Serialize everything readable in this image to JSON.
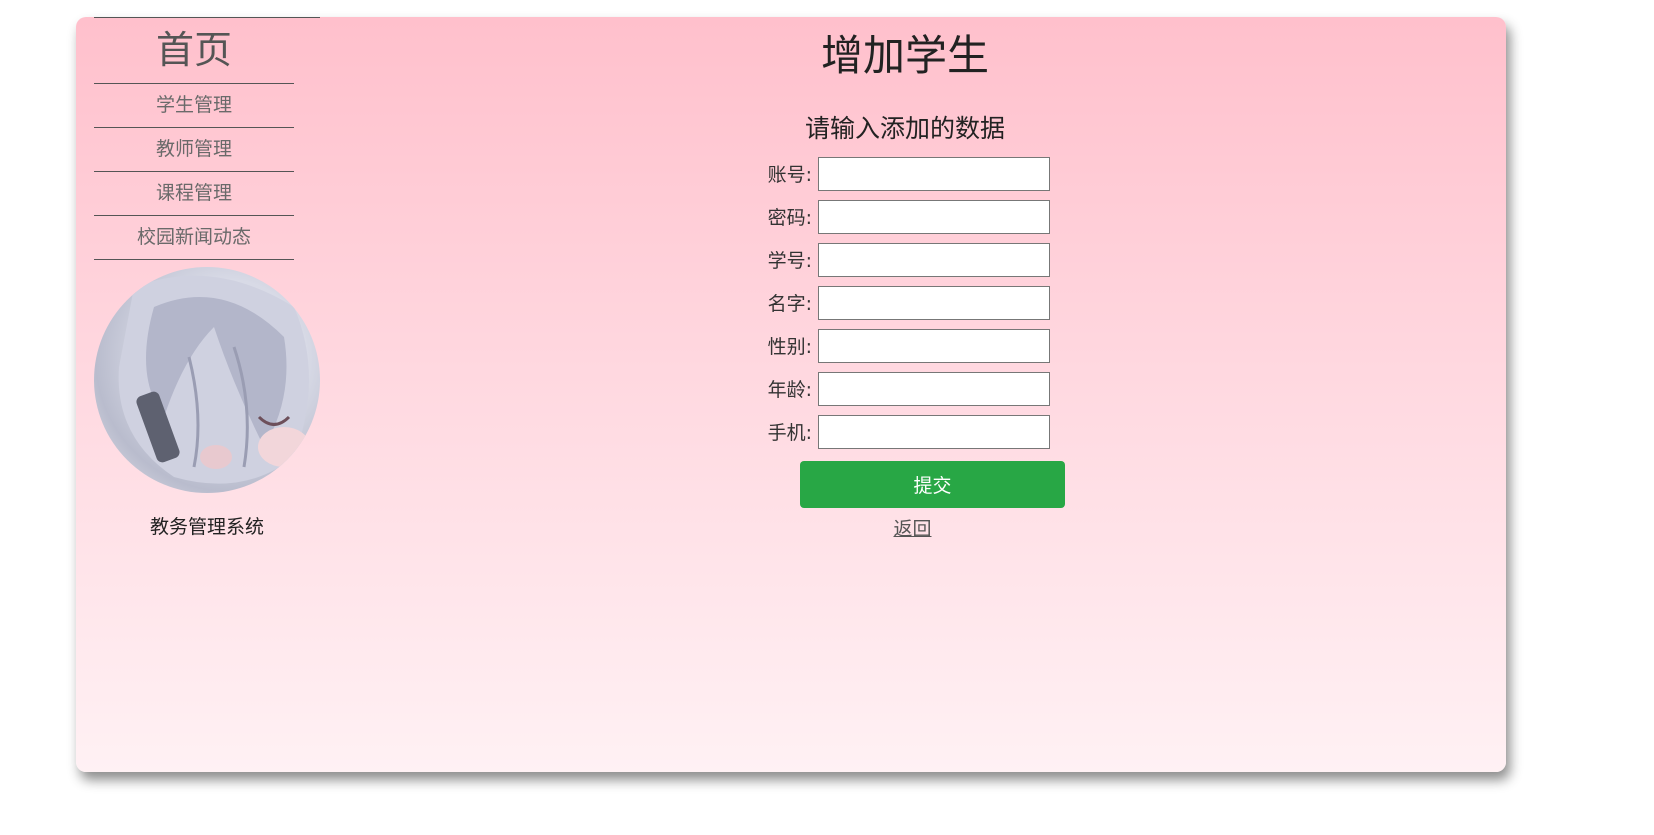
{
  "sidebar": {
    "home_label": "首页",
    "items": [
      {
        "label": "学生管理"
      },
      {
        "label": "教师管理"
      },
      {
        "label": "课程管理"
      },
      {
        "label": "校园新闻动态"
      }
    ],
    "system_name": "教务管理系统"
  },
  "main": {
    "title": "增加学生",
    "subtitle": "请输入添加的数据",
    "fields": [
      {
        "label": "账号:",
        "value": ""
      },
      {
        "label": "密码:",
        "value": ""
      },
      {
        "label": "学号:",
        "value": ""
      },
      {
        "label": "名字:",
        "value": ""
      },
      {
        "label": "性别:",
        "value": ""
      },
      {
        "label": "年龄:",
        "value": ""
      },
      {
        "label": "手机:",
        "value": ""
      }
    ],
    "submit_label": "提交",
    "back_label": "返回"
  },
  "colors": {
    "card_top": "#ffc0cc",
    "card_bottom": "#fff1f4",
    "submit_bg": "#28a745"
  }
}
